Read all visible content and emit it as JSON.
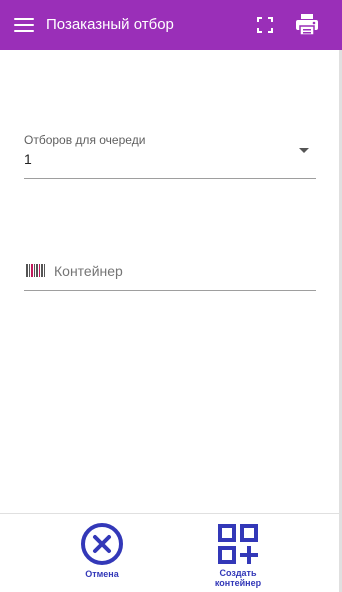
{
  "colors": {
    "appbar": "#9a2fb8",
    "accent": "#3338b8",
    "text": "#222222",
    "label": "#5f5f5f"
  },
  "header": {
    "title": "Позаказный отбор",
    "menu_icon": "hamburger-menu-icon",
    "fullscreen_icon": "fullscreen-icon",
    "print_icon": "printer-icon"
  },
  "form": {
    "queue_field": {
      "label": "Отборов для очереди",
      "value": "1",
      "icon": "dropdown-arrow-icon"
    },
    "container_field": {
      "placeholder": "Контейнер",
      "value": "",
      "icon": "barcode-icon"
    }
  },
  "bottom_bar": {
    "cancel": {
      "label": "Отмена",
      "icon": "cancel-circle-icon"
    },
    "create": {
      "label_line1": "Создать",
      "label_line2": "контейнер",
      "icon": "qr-add-icon"
    }
  }
}
